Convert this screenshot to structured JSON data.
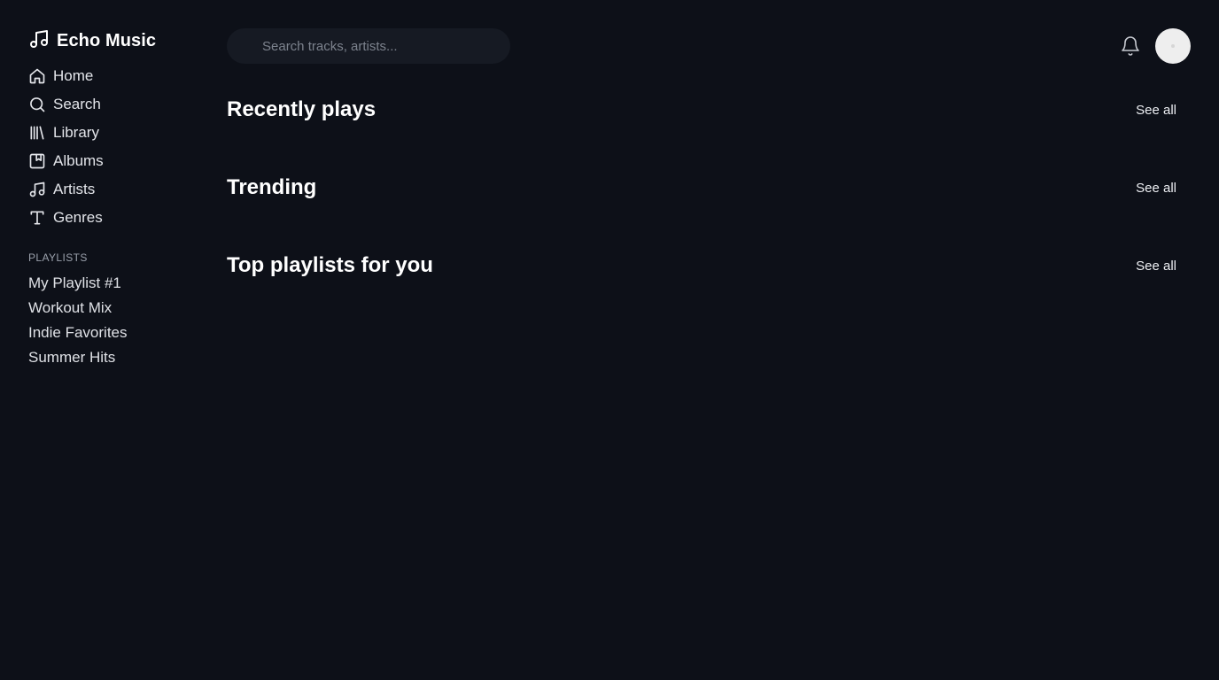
{
  "brand": {
    "name": "Echo Music",
    "icon": "music-note-icon"
  },
  "nav": [
    {
      "label": "Home",
      "icon": "home-icon"
    },
    {
      "label": "Search",
      "icon": "search-icon"
    },
    {
      "label": "Library",
      "icon": "library-icon"
    },
    {
      "label": "Albums",
      "icon": "album-icon"
    },
    {
      "label": "Artists",
      "icon": "music-note-icon"
    },
    {
      "label": "Genres",
      "icon": "type-icon"
    }
  ],
  "playlists": {
    "heading": "PLAYLISTS",
    "items": [
      "My Playlist #1",
      "Workout Mix",
      "Indie Favorites",
      "Summer Hits"
    ]
  },
  "header": {
    "search_placeholder": "Search tracks, artists...",
    "bell_icon": "bell-icon"
  },
  "sections": [
    {
      "title": "Recently plays",
      "link": "See all"
    },
    {
      "title": "Trending",
      "link": "See all"
    },
    {
      "title": "Top playlists for you",
      "link": "See all"
    }
  ],
  "colors": {
    "background": "#0d1018",
    "search_bg": "#161a23",
    "text": "#ffffff",
    "muted": "#9aa0ab"
  }
}
